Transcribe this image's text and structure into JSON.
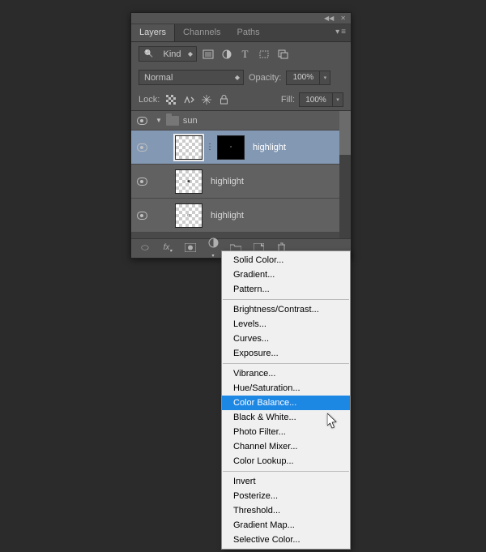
{
  "tabs": {
    "layers": "Layers",
    "channels": "Channels",
    "paths": "Paths"
  },
  "filter": {
    "kind": "Kind"
  },
  "blend": {
    "mode": "Normal",
    "opacity_label": "Opacity:",
    "opacity": "100%"
  },
  "lock": {
    "label": "Lock:",
    "fill_label": "Fill:",
    "fill": "100%"
  },
  "group": {
    "name": "sun"
  },
  "layers": [
    {
      "name": "highlight",
      "selected": true,
      "masked": true
    },
    {
      "name": "highlight",
      "selected": false,
      "masked": false
    },
    {
      "name": "highlight",
      "selected": false,
      "masked": false
    }
  ],
  "menu": {
    "g1": [
      "Solid Color...",
      "Gradient...",
      "Pattern..."
    ],
    "g2": [
      "Brightness/Contrast...",
      "Levels...",
      "Curves...",
      "Exposure..."
    ],
    "g3": [
      "Vibrance...",
      "Hue/Saturation...",
      "Color Balance...",
      "Black & White...",
      "Photo Filter...",
      "Channel Mixer...",
      "Color Lookup..."
    ],
    "g4": [
      "Invert",
      "Posterize...",
      "Threshold...",
      "Gradient Map...",
      "Selective Color..."
    ],
    "hovered": "Color Balance..."
  }
}
